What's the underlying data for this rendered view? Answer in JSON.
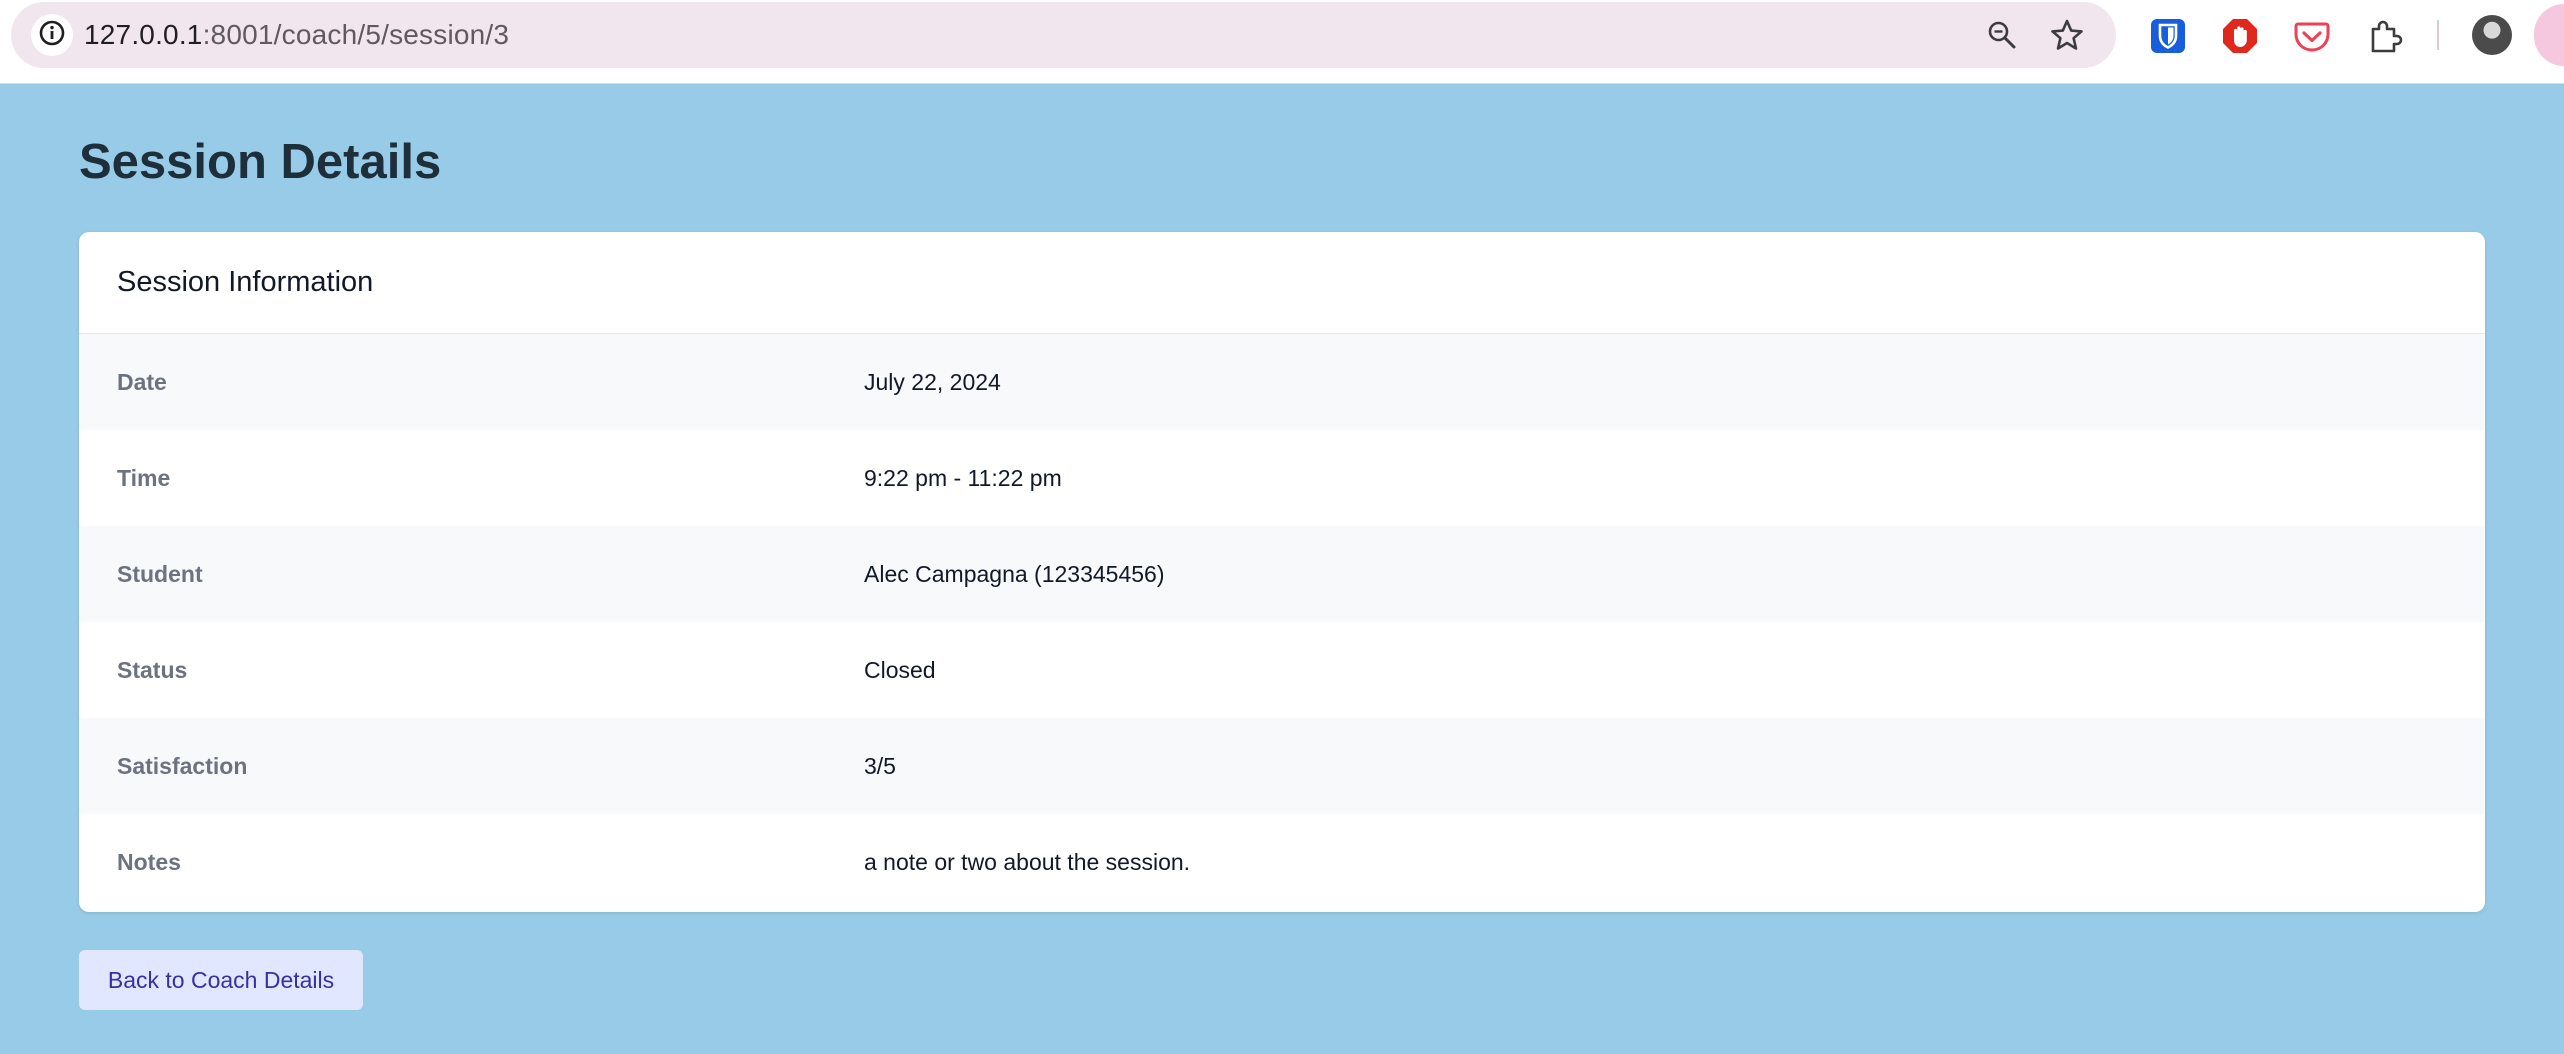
{
  "browser": {
    "url_host": "127.0.0.1",
    "url_rest": ":8001/coach/5/session/3",
    "icons": [
      "info-icon",
      "zoom-icon",
      "star-icon",
      "bitwarden-icon",
      "adblock-icon",
      "pocket-icon",
      "extensions-icon",
      "avatar"
    ],
    "colors": {
      "bitwarden": "#175ddc",
      "adblock": "#e0291e",
      "pocket": "#ef4056"
    }
  },
  "page": {
    "title": "Session Details",
    "card_title": "Session Information",
    "rows": [
      {
        "label": "Date",
        "value": "July 22, 2024"
      },
      {
        "label": "Time",
        "value": "9:22 pm - 11:22 pm"
      },
      {
        "label": "Student",
        "value": "Alec Campagna (123345456)"
      },
      {
        "label": "Status",
        "value": "Closed"
      },
      {
        "label": "Satisfaction",
        "value": "3/5"
      },
      {
        "label": "Notes",
        "value": "a note or two about the session."
      }
    ],
    "back_button": "Back to Coach Details"
  },
  "colors": {
    "background": "#98cbe7",
    "title": "#1e2e3b",
    "button_bg": "#e0e7ff",
    "button_text": "#3730a3"
  }
}
